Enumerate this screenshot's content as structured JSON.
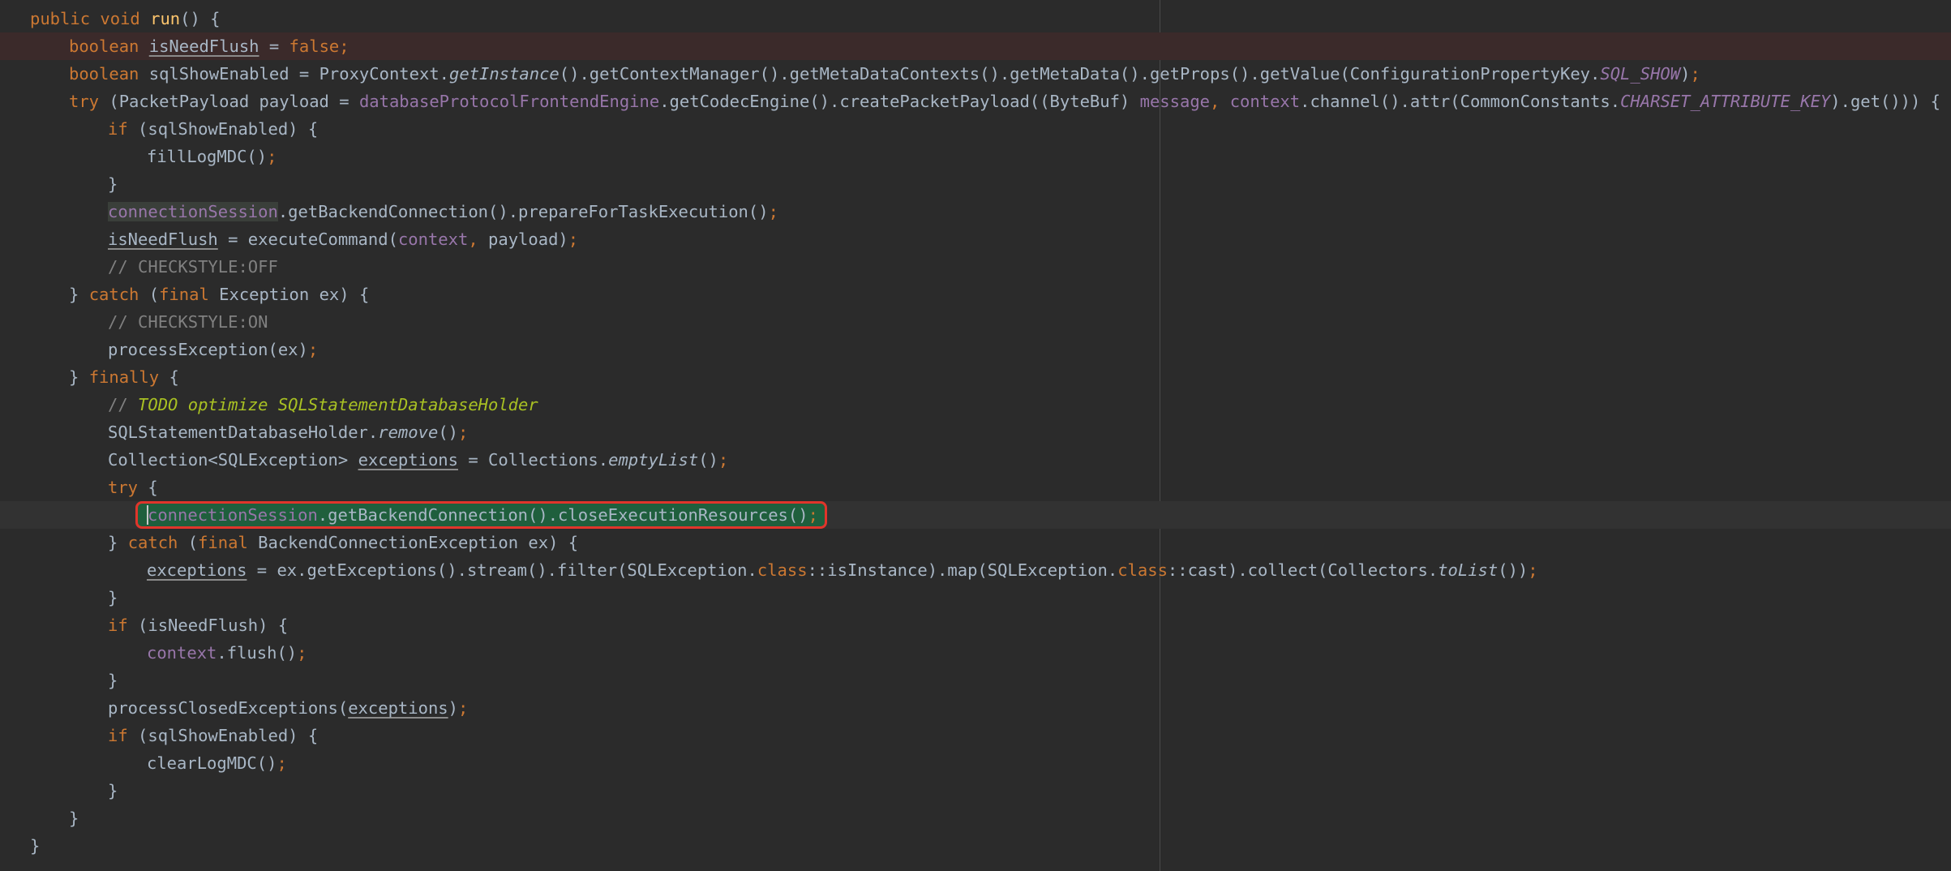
{
  "editor": {
    "lines": [
      {
        "indent": 0,
        "tokens": [
          [
            "kw",
            "public "
          ],
          [
            "kw",
            "void "
          ],
          [
            "fn",
            "run"
          ],
          [
            "",
            "() {"
          ]
        ]
      },
      {
        "indent": 1,
        "style": "error",
        "tokens": [
          [
            "kw",
            "boolean "
          ],
          [
            "ul",
            "isNeedFlush"
          ],
          [
            "",
            " = "
          ],
          [
            "kw",
            "false"
          ],
          [
            "kw",
            ";"
          ]
        ]
      },
      {
        "indent": 1,
        "tokens": [
          [
            "kw",
            "boolean "
          ],
          [
            "",
            "sqlShowEnabled = ProxyContext."
          ],
          [
            "it",
            "getInstance"
          ],
          [
            "",
            "().getContextManager().getMetaDataContexts().getMetaData().getProps().getValue(ConfigurationPropertyKey."
          ],
          [
            "static",
            "SQL_SHOW"
          ],
          [
            "",
            ")"
          ],
          [
            "kw",
            ";"
          ]
        ]
      },
      {
        "indent": 1,
        "tokens": [
          [
            "kw",
            "try "
          ],
          [
            "",
            "(PacketPayload payload = "
          ],
          [
            "fld",
            "databaseProtocolFrontendEngine"
          ],
          [
            "",
            ".getCodecEngine().createPacketPayload((ByteBuf) "
          ],
          [
            "fld",
            "message"
          ],
          [
            "kw",
            ", "
          ],
          [
            "fld",
            "context"
          ],
          [
            "",
            ".channel().attr(CommonConstants."
          ],
          [
            "static",
            "CHARSET_ATTRIBUTE_KEY"
          ],
          [
            "",
            ").get())) {"
          ]
        ]
      },
      {
        "indent": 2,
        "tokens": [
          [
            "kw",
            "if "
          ],
          [
            "",
            "(sqlShowEnabled) {"
          ]
        ]
      },
      {
        "indent": 3,
        "tokens": [
          [
            "",
            "fillLogMDC()"
          ],
          [
            "kw",
            ";"
          ]
        ]
      },
      {
        "indent": 2,
        "tokens": [
          [
            "",
            "}"
          ]
        ]
      },
      {
        "indent": 2,
        "tokens": [
          [
            "fldhl",
            "connectionSession"
          ],
          [
            "",
            ".getBackendConnection().prepareForTaskExecution()"
          ],
          [
            "kw",
            ";"
          ]
        ]
      },
      {
        "indent": 2,
        "tokens": [
          [
            "ul",
            "isNeedFlush"
          ],
          [
            "",
            " = executeCommand("
          ],
          [
            "fld",
            "context"
          ],
          [
            "kw",
            ", "
          ],
          [
            "",
            "payload)"
          ],
          [
            "kw",
            ";"
          ]
        ]
      },
      {
        "indent": 2,
        "tokens": [
          [
            "cm",
            "// CHECKSTYLE:OFF"
          ]
        ]
      },
      {
        "indent": 1,
        "tokens": [
          [
            "",
            "} "
          ],
          [
            "kw",
            "catch "
          ],
          [
            "",
            "("
          ],
          [
            "kw",
            "final "
          ],
          [
            "",
            "Exception ex) {"
          ]
        ]
      },
      {
        "indent": 2,
        "tokens": [
          [
            "cm",
            "// CHECKSTYLE:ON"
          ]
        ]
      },
      {
        "indent": 2,
        "tokens": [
          [
            "",
            "processException(ex)"
          ],
          [
            "kw",
            ";"
          ]
        ]
      },
      {
        "indent": 1,
        "tokens": [
          [
            "",
            "} "
          ],
          [
            "kw",
            "finally "
          ],
          [
            "",
            "{"
          ]
        ]
      },
      {
        "indent": 2,
        "tokens": [
          [
            "cm",
            "// "
          ],
          [
            "todo",
            "TODO optimize SQLStatementDatabaseHolder"
          ]
        ]
      },
      {
        "indent": 2,
        "tokens": [
          [
            "",
            "SQLStatementDatabaseHolder."
          ],
          [
            "it",
            "remove"
          ],
          [
            "",
            "()"
          ],
          [
            "kw",
            ";"
          ]
        ]
      },
      {
        "indent": 2,
        "tokens": [
          [
            "",
            "Collection<SQLException> "
          ],
          [
            "ul",
            "exceptions"
          ],
          [
            "",
            " = Collections."
          ],
          [
            "it",
            "emptyList"
          ],
          [
            "",
            "()"
          ],
          [
            "kw",
            ";"
          ]
        ]
      },
      {
        "indent": 2,
        "tokens": [
          [
            "kw",
            "try "
          ],
          [
            "",
            "{"
          ]
        ]
      },
      {
        "indent": 3,
        "style": "current",
        "selected": true,
        "tokens": [
          [
            "fld",
            "connectionSession"
          ],
          [
            "",
            ".getBackendConnection().closeExecutionResources()"
          ],
          [
            "kw",
            ";"
          ]
        ]
      },
      {
        "indent": 2,
        "tokens": [
          [
            "",
            "} "
          ],
          [
            "kw",
            "catch "
          ],
          [
            "",
            "("
          ],
          [
            "kw",
            "final "
          ],
          [
            "",
            "BackendConnectionException ex) {"
          ]
        ]
      },
      {
        "indent": 3,
        "tokens": [
          [
            "ul",
            "exceptions"
          ],
          [
            "",
            " = ex.getExceptions().stream().filter(SQLException."
          ],
          [
            "kw",
            "class"
          ],
          [
            "",
            "::isInstance).map(SQLException."
          ],
          [
            "kw",
            "class"
          ],
          [
            "",
            "::cast).collect(Collectors."
          ],
          [
            "it",
            "toList"
          ],
          [
            "",
            "())"
          ],
          [
            "kw",
            ";"
          ]
        ]
      },
      {
        "indent": 2,
        "tokens": [
          [
            "",
            "}"
          ]
        ]
      },
      {
        "indent": 2,
        "tokens": [
          [
            "kw",
            "if "
          ],
          [
            "",
            "(isNeedFlush) {"
          ]
        ]
      },
      {
        "indent": 3,
        "tokens": [
          [
            "fld",
            "context"
          ],
          [
            "",
            ".flush()"
          ],
          [
            "kw",
            ";"
          ]
        ]
      },
      {
        "indent": 2,
        "tokens": [
          [
            "",
            "}"
          ]
        ]
      },
      {
        "indent": 2,
        "tokens": [
          [
            "",
            "processClosedExceptions("
          ],
          [
            "ul",
            "exceptions"
          ],
          [
            "",
            ")"
          ],
          [
            "kw",
            ";"
          ]
        ]
      },
      {
        "indent": 2,
        "tokens": [
          [
            "kw",
            "if "
          ],
          [
            "",
            "(sqlShowEnabled) {"
          ]
        ]
      },
      {
        "indent": 3,
        "tokens": [
          [
            "",
            "clearLogMDC()"
          ],
          [
            "kw",
            ";"
          ]
        ]
      },
      {
        "indent": 2,
        "tokens": [
          [
            "",
            "}"
          ]
        ]
      },
      {
        "indent": 1,
        "tokens": [
          [
            "",
            "}"
          ]
        ]
      },
      {
        "indent": 0,
        "tokens": [
          [
            "",
            "}"
          ]
        ]
      }
    ]
  },
  "colors": {
    "background": "#2b2b2b",
    "keyword": "#cc7832",
    "method_decl": "#ffc66d",
    "field": "#9876aa",
    "comment": "#808080",
    "todo": "#a8c023",
    "selection_box": "#e0352b"
  }
}
